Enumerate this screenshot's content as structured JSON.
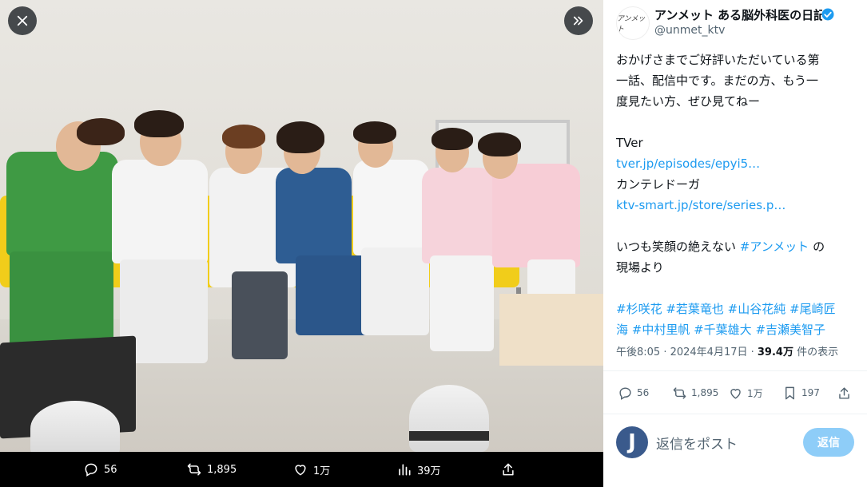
{
  "media_bar": {
    "replies": "56",
    "reposts": "1,895",
    "likes": "1万",
    "views": "39万"
  },
  "author": {
    "name": "アンメット ある脳外科医の日記",
    "handle": "@unmet_ktv",
    "avatar_text": "アンメット"
  },
  "tweet": {
    "lines": [
      "おかげさまでご好評いただいている第",
      "一話、配信中です。まだの方、もう一",
      "度見たい方、ぜひ見てねー"
    ],
    "tver_label": "TVer",
    "tver_link": "tver.jp/episodes/epyi5…",
    "ktv_label": "カンテレドーガ",
    "ktv_link": "ktv-smart.jp/store/series.p…",
    "closing_pre": "いつも笑顔の絶えない ",
    "closing_tag": "#アンメット",
    "closing_post": " の",
    "closing_line2": "現場より",
    "hashtags_line1": "#杉咲花 #若葉竜也 #山谷花純 #尾崎匠",
    "hashtags_line2": "海 #中村里帆 #千葉雄大 #吉瀬美智子"
  },
  "meta": {
    "time": "午後8:05 · 2024年4月17日 · ",
    "views": "39.4万",
    "views_suffix": " 件の表示"
  },
  "actions": {
    "replies": "56",
    "reposts": "1,895",
    "likes": "1万",
    "bookmarks": "197"
  },
  "reply": {
    "avatar_letter": "J",
    "placeholder": "返信をポスト",
    "button": "返信"
  },
  "colors": {
    "accent": "#1d9bf0",
    "reply_button": "#8ecdf8",
    "text": "#0f1419",
    "muted": "#536471"
  }
}
